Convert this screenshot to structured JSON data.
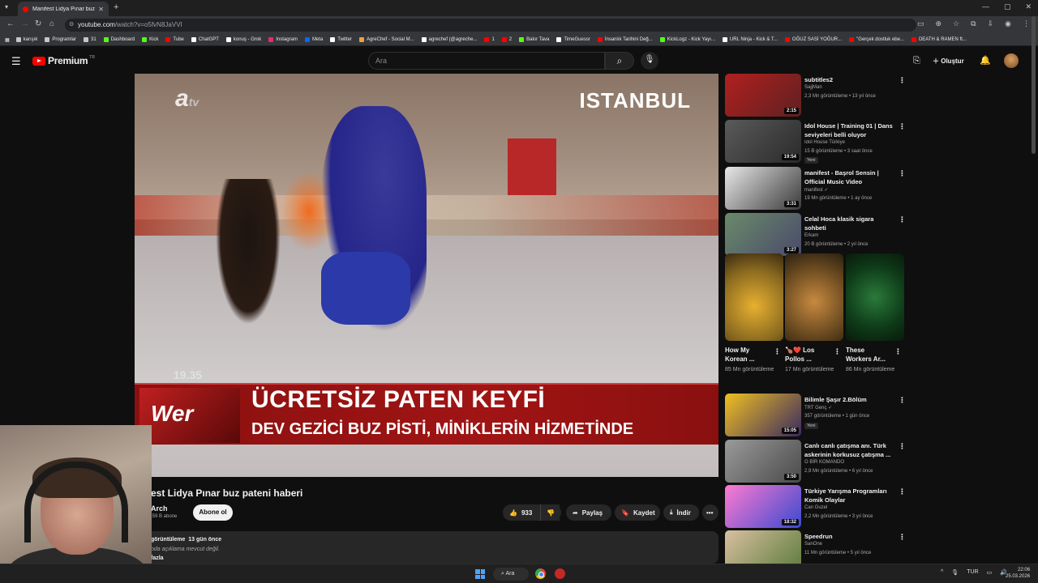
{
  "browser": {
    "tab_title": "Manifest Lidya Pınar buz paten",
    "url_host": "youtube.com",
    "url_path": "/watch?v=o5fvN8JaVVI",
    "bookmarks": [
      {
        "label": "karışık",
        "color": "#c4c7c5"
      },
      {
        "label": "Programlar",
        "color": "#c4c7c5"
      },
      {
        "label": "31",
        "color": "#c4c7c5"
      },
      {
        "label": "Dashboard",
        "color": "#53fc18"
      },
      {
        "label": "Kick",
        "color": "#53fc18"
      },
      {
        "label": "Tube",
        "color": "#ff0000"
      },
      {
        "label": "ChatGPT",
        "color": "#ffffff"
      },
      {
        "label": "konuş - Grok",
        "color": "#ffffff"
      },
      {
        "label": "Instagram",
        "color": "#e1306c"
      },
      {
        "label": "Meta",
        "color": "#0866ff"
      },
      {
        "label": "Twitter",
        "color": "#ffffff"
      },
      {
        "label": "AgreChef - Social M...",
        "color": "#f0a040"
      },
      {
        "label": "agrechef (@agreche...",
        "color": "#ffffff"
      },
      {
        "label": "1",
        "color": "#ff0000"
      },
      {
        "label": "2",
        "color": "#ff0000"
      },
      {
        "label": "Bakır Tava",
        "color": "#53fc18"
      },
      {
        "label": "TimeGuessr",
        "color": "#ffffff"
      },
      {
        "label": "İnsanlık Tarihini Değ...",
        "color": "#ff0000"
      },
      {
        "label": "KickLogz - Kick Yayı...",
        "color": "#53fc18"
      },
      {
        "label": "URL Ninja - Kick & T...",
        "color": "#ffffff"
      },
      {
        "label": "OĞUZ SASİ YOĞUR...",
        "color": "#ff0000"
      },
      {
        "label": "\"Gerçek dostluk ebe...",
        "color": "#ff0000"
      },
      {
        "label": "DEATH & RAMEN ft...",
        "color": "#ff0000"
      }
    ]
  },
  "youtube": {
    "logo_text": "Premium",
    "country_code": "TR",
    "search_placeholder": "Ara",
    "create_label": "Oluştur",
    "video": {
      "title": "est Lidya Pınar buz pateni haberi",
      "channel": "Arch",
      "subscribers": ",59 B abone",
      "subscribe_label": "Abone ol",
      "likes": "933",
      "share_label": "Paylaş",
      "save_label": "Kaydet",
      "download_label": "İndir",
      "views": "görüntüleme",
      "age": "13 gün önce",
      "description": "oda açıklama mevcut değil.",
      "more_label": "fazla",
      "overlay": {
        "channel_logo": "a",
        "channel_logo_suffix": "tv",
        "location": "ISTANBUL",
        "timecode": "19.35",
        "lower_third_logo": "Wer",
        "headline": "ÜCRETSİZ PATEN KEYFİ",
        "subheadline": "DEV GEZİCİ BUZ PİSTİ, MİNİKLERİN HİZMETİNDE"
      }
    },
    "recommendations": [
      {
        "title": "subtitles2",
        "channel": "SajjMan",
        "meta": "2,3 Mn görüntüleme • 13 yıl önce",
        "duration": "2:15",
        "badge": ""
      },
      {
        "title": "Idol House | Training 01 | Dans seviyeleri belli oluyor",
        "channel": "Idol House Türkiye",
        "meta": "15 B görüntüleme • 3 saat önce",
        "duration": "19:54",
        "badge": "Yeni"
      },
      {
        "title": "manifest - Başrol Sensin | Official Music Video",
        "channel": "manifest ✓",
        "meta": "19 Mn görüntüleme • 1 ay önce",
        "duration": "3:31",
        "badge": ""
      },
      {
        "title": "Celal Hoca klasik sigara sohbeti",
        "channel": "Erkam",
        "meta": "20 B görüntüleme • 2 yıl önce",
        "duration": "3:27",
        "badge": ""
      },
      {
        "title": "Bilimle Şaşır 2.Bölüm",
        "channel": "TRT Genç ✓",
        "meta": "357 görüntüleme • 1 gün önce",
        "duration": "15:05",
        "badge": "Yeni"
      },
      {
        "title": "Canlı canlı çatışma anı. Türk askerinin korkusuz çatışma ...",
        "channel": "O BİR KOMANDO",
        "meta": "2,9 Mn görüntüleme • 6 yıl önce",
        "duration": "3:50",
        "badge": ""
      },
      {
        "title": "Türkiye Yarışma Programları Komik Olaylar",
        "channel": "Can Guzel",
        "meta": "2,2 Mn görüntüleme • 3 yıl önce",
        "duration": "18:32",
        "badge": ""
      },
      {
        "title": "Speedrun",
        "channel": "SanOne",
        "meta": "11 Mn görüntüleme • 5 yıl önce",
        "duration": "",
        "badge": ""
      }
    ],
    "shorts": [
      {
        "title": "How My Korean ...",
        "views": "85 Mn görüntüleme"
      },
      {
        "title": "🍗❤️ Los Pollos ...",
        "views": "17 Mn görüntüleme"
      },
      {
        "title": "These Workers Ar...",
        "views": "86 Mn görüntüleme"
      }
    ]
  },
  "taskbar": {
    "search_label": "Ara",
    "lang": "TUR",
    "time": "22:06",
    "date": "25.03.2026"
  }
}
